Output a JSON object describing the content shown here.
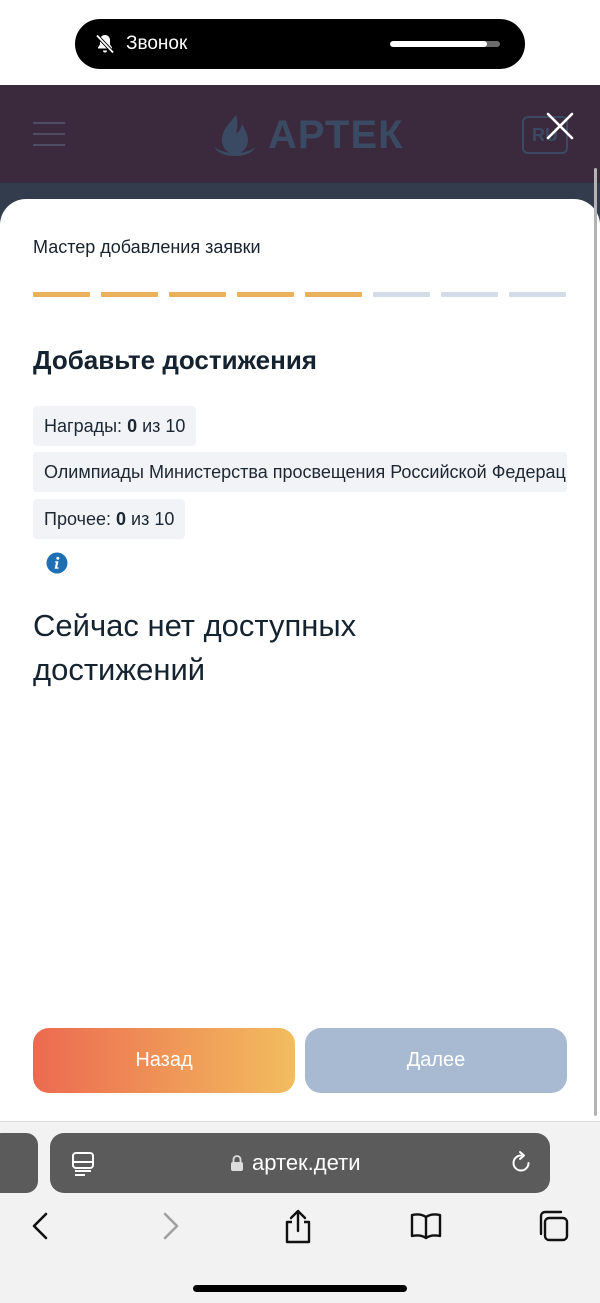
{
  "status": {
    "call_label": "Звонок",
    "call_progress": 0.88
  },
  "site": {
    "logo_text": "АРТЕК",
    "lang": "RU"
  },
  "wizard": {
    "title": "Мастер добавления заявки",
    "steps_total": 8,
    "steps_completed": 5,
    "section_title": "Добавьте достижения",
    "chips": {
      "awards_label": "Награды:",
      "awards_count": "0",
      "awards_of": "из 10",
      "olympiads": "Олимпиады Министерства просвещения Российской Федерации",
      "other_label": "Прочее:",
      "other_count": "0",
      "other_of": "из 10"
    },
    "empty_message": "Сейчас нет доступных достижений",
    "back_label": "Назад",
    "next_label": "Далее"
  },
  "browser": {
    "url": "артек.дети"
  },
  "icons": {
    "bell": "bell-slash-icon",
    "close": "close-icon",
    "menu": "hamburger-menu-icon",
    "info": "info-icon",
    "reader": "reader-mode-icon",
    "lock": "lock-icon",
    "reload": "reload-icon",
    "back": "chevron-left-icon",
    "forward": "chevron-right-icon",
    "share": "share-icon",
    "bookmarks": "book-icon",
    "tabs": "tabs-icon"
  },
  "colors": {
    "step_done": "#eab15b",
    "step_todo": "#d3dde8",
    "back_gradient_start": "#ec6a50",
    "back_gradient_end": "#f2bd5e",
    "next_disabled": "#a7bad1",
    "info_blue": "#1f6fb5"
  }
}
